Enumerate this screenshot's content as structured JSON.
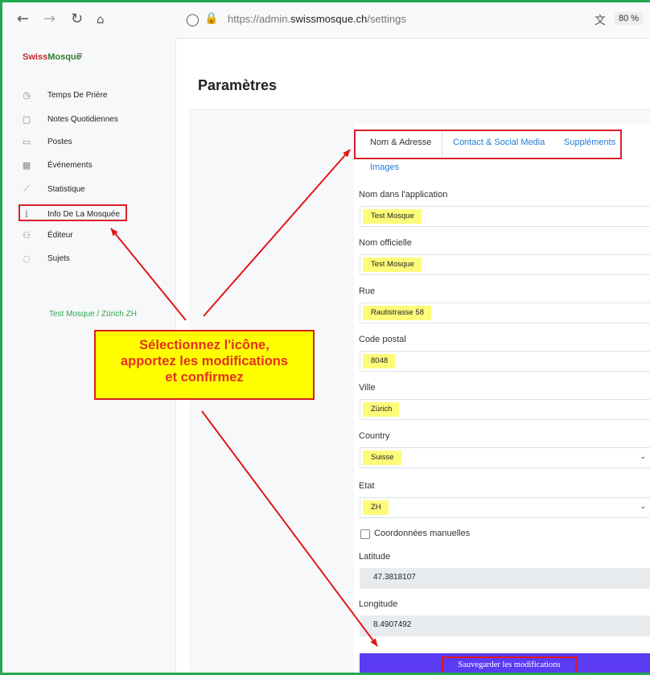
{
  "browser": {
    "url_prefix": "https://admin.",
    "url_domain": "swissmosque.ch",
    "url_path": "/settings",
    "zoom": "80 %",
    "icons": [
      "back-arrow-icon",
      "forward-arrow-icon",
      "reload-icon",
      "home-icon",
      "shield-icon",
      "lock-icon",
      "key-icon",
      "translate-icon"
    ]
  },
  "brand": {
    "part1": "Swiss",
    "part2": "Mosque"
  },
  "sidebar": {
    "items": [
      {
        "label": "Temps De Prière",
        "icon": "clock-icon"
      },
      {
        "label": "Notes Quotidiennes",
        "icon": "note-icon"
      },
      {
        "label": "Postes",
        "icon": "chat-icon"
      },
      {
        "label": "Événements",
        "icon": "calendar-icon"
      },
      {
        "label": "Statistique",
        "icon": "chart-icon"
      },
      {
        "label": "Info De La Mosquée",
        "icon": "info-icon"
      },
      {
        "label": "Éditeur",
        "icon": "users-icon"
      },
      {
        "label": "Sujets",
        "icon": "message-icon"
      }
    ],
    "mosque": "Test Mosque / Zürich ZH"
  },
  "page": {
    "title": "Paramètres"
  },
  "tabs": {
    "nom_adresse": "Nom & Adresse",
    "contact": "Contact & Social Media",
    "supplements": "Suppléments",
    "images": "Images"
  },
  "form": {
    "app_name_label": "Nom dans l'application",
    "app_name_value": "Test Mosque",
    "official_name_label": "Nom officielle",
    "official_name_value": "Test Mosque",
    "street_label": "Rue",
    "street_value": "Rautistrasse 58",
    "postal_label": "Code postal",
    "postal_value": "8048",
    "city_label": "Ville",
    "city_value": "Zürich",
    "country_label": "Country",
    "country_value": "Suisse",
    "state_label": "Etat",
    "state_value": "ZH",
    "manual_coords_label": "Coordonnées manuelles",
    "latitude_label": "Latitude",
    "latitude_value": "47.3818107",
    "longitude_label": "Longitude",
    "longitude_value": "8.4907492",
    "save_label": "Sauvegarder les modifications"
  },
  "callout": {
    "line1": "Sélectionnez l'icône,",
    "line2": "apportez les modifications",
    "line3": "et confirmez"
  },
  "colors": {
    "accent": "#5b3cf2",
    "annotation_red": "#d71f2a",
    "highlight": "#fcfc7a",
    "callout_bg": "#ffff00",
    "green_border": "#23a850"
  }
}
